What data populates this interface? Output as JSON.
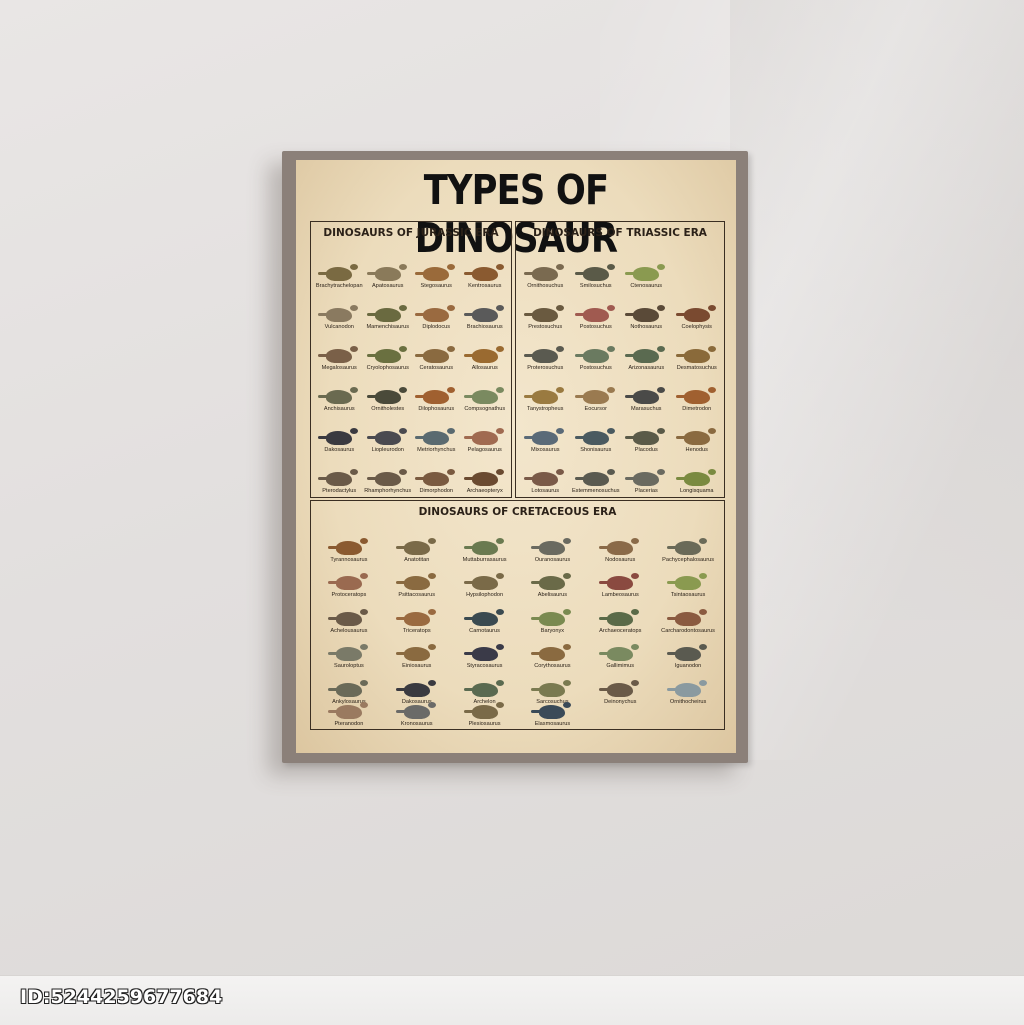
{
  "poster": {
    "title": "TYPES OF DINOSAUR",
    "colors": {
      "paper": "#ecdcbc",
      "ink": "#2b2118",
      "region_text": "#a33a2a",
      "frame": "#8b8079"
    },
    "jurassic": {
      "heading": "DINOSAURS OF JURASSIC ERA",
      "items": [
        {
          "name": "Brachytrachelopan",
          "color": "#7a6a42"
        },
        {
          "name": "Apatosaurus",
          "color": "#8a7a5a"
        },
        {
          "name": "Stegosaurus",
          "color": "#9a6a3a"
        },
        {
          "name": "Kentrosaurus",
          "color": "#8a5a30"
        },
        {
          "name": "Vulcanodon",
          "color": "#8a7a60"
        },
        {
          "name": "Mamenchisaurus",
          "color": "#6a6a40"
        },
        {
          "name": "Diplodocus",
          "color": "#9a6a40"
        },
        {
          "name": "Brachiosaurus",
          "color": "#5a5a5a"
        },
        {
          "name": "Megalosaurus",
          "color": "#7a6048"
        },
        {
          "name": "Cryolophosaurus",
          "color": "#6a7040"
        },
        {
          "name": "Ceratosaurus",
          "color": "#8a6a40"
        },
        {
          "name": "Allosaurus",
          "color": "#9a6a30"
        },
        {
          "name": "Anchisaurus",
          "color": "#6a6a50"
        },
        {
          "name": "Ornitholestes",
          "color": "#4a4a3a"
        },
        {
          "name": "Dilophosaurus",
          "color": "#a06030"
        },
        {
          "name": "Compsognathus",
          "color": "#7a8a60"
        },
        {
          "name": "Dakosaurus",
          "color": "#3a3a40"
        },
        {
          "name": "Liopleurodon",
          "color": "#4a4a50"
        },
        {
          "name": "Metriorhynchus",
          "color": "#5a6a70"
        },
        {
          "name": "Pelagosaurus",
          "color": "#a06a50"
        },
        {
          "name": "Pterodactylus",
          "color": "#6a5a48"
        },
        {
          "name": "Rhamphorhynchus",
          "color": "#6a5a48"
        },
        {
          "name": "Dimorphodon",
          "color": "#7a5a40"
        },
        {
          "name": "Archaeopteryx",
          "color": "#6a4a30"
        }
      ]
    },
    "triassic": {
      "heading": "DINOSAURS OF TRIASSIC ERA",
      "items": [
        {
          "name": "Ornithosuchus",
          "color": "#7a6a50"
        },
        {
          "name": "Smilosuchus",
          "color": "#5a5a48"
        },
        {
          "name": "Ctenosaurus",
          "color": "#8a9a50"
        },
        {
          "name": "",
          "color": "#00000000"
        },
        {
          "name": "Prestosuchus",
          "color": "#6a5a40"
        },
        {
          "name": "Postosuchus",
          "color": "#a05a50"
        },
        {
          "name": "Nothosaurus",
          "color": "#5a4a38"
        },
        {
          "name": "Coelophysis",
          "color": "#7a4a30"
        },
        {
          "name": "Proterosuchus",
          "color": "#5a5a50"
        },
        {
          "name": "Postosuchus",
          "color": "#6a7a60"
        },
        {
          "name": "Arizonasaurus",
          "color": "#5a6a50"
        },
        {
          "name": "Desmatosuchus",
          "color": "#8a6a3a"
        },
        {
          "name": "Tanystropheus",
          "color": "#9a7a40"
        },
        {
          "name": "Eocursor",
          "color": "#9a7a50"
        },
        {
          "name": "Marasuchus",
          "color": "#4a4a48"
        },
        {
          "name": "Dimetrodon",
          "color": "#a06030"
        },
        {
          "name": "Mixosaurus",
          "color": "#5a6a78"
        },
        {
          "name": "Shonisaurus",
          "color": "#4a5a60"
        },
        {
          "name": "Placodus",
          "color": "#5a5a48"
        },
        {
          "name": "Henodus",
          "color": "#8a6a40"
        },
        {
          "name": "Lotosaurus",
          "color": "#7a5a48"
        },
        {
          "name": "Estemmenosuchus",
          "color": "#5a5a50"
        },
        {
          "name": "Placerias",
          "color": "#6a6a60"
        },
        {
          "name": "Longisquama",
          "color": "#7a8a40"
        }
      ]
    },
    "cretaceous": {
      "heading": "DINOSAURS OF CRETACEOUS ERA",
      "items": [
        {
          "name": "Tyrannosaurus",
          "color": "#8a5a30"
        },
        {
          "name": "Anatotitan",
          "color": "#7a6a48"
        },
        {
          "name": "Muttaburrasaurus",
          "color": "#6a7a50"
        },
        {
          "name": "Ouranosaurus",
          "color": "#6a6a60"
        },
        {
          "name": "Nodosaurus",
          "color": "#8a6a48"
        },
        {
          "name": "Pachycephalosaurus",
          "color": "#6a6a58"
        },
        {
          "name": "Protoceratops",
          "color": "#9a6a50"
        },
        {
          "name": "Psittacosaurus",
          "color": "#8a6a40"
        },
        {
          "name": "Hypsilophodon",
          "color": "#7a6a48"
        },
        {
          "name": "Abelisaurus",
          "color": "#6a6a48"
        },
        {
          "name": "Lambeosaurus",
          "color": "#8a4a40"
        },
        {
          "name": "Tsintaosaurus",
          "color": "#8a9a50"
        },
        {
          "name": "Achelousaurus",
          "color": "#6a5a48"
        },
        {
          "name": "Triceratops",
          "color": "#9a6a40"
        },
        {
          "name": "Carnotaurus",
          "color": "#3a4a50"
        },
        {
          "name": "Baryonyx",
          "color": "#7a8a50"
        },
        {
          "name": "Archaeoceratops",
          "color": "#5a6a48"
        },
        {
          "name": "Carcharodontosaurus",
          "color": "#8a5a40"
        },
        {
          "name": "Sauroloptus",
          "color": "#7a7a68"
        },
        {
          "name": "Einiosaurus",
          "color": "#8a6a40"
        },
        {
          "name": "Styracosaurus",
          "color": "#3a3a48"
        },
        {
          "name": "Corythosaurus",
          "color": "#8a6a40"
        },
        {
          "name": "Gallimimus",
          "color": "#7a8a60"
        },
        {
          "name": "Iguanodon",
          "color": "#5a5a50"
        },
        {
          "name": "Ankylosaurus",
          "color": "#6a6a58"
        },
        {
          "name": "Dakosaurus",
          "color": "#3a3a40"
        },
        {
          "name": "Archelon",
          "color": "#5a6a50"
        },
        {
          "name": "Sarcosuchus",
          "color": "#7a7a50"
        },
        {
          "name": "Deinonychus",
          "color": "#6a5a48"
        },
        {
          "name": "Ornithocheirus",
          "color": "#8a9aa0"
        },
        {
          "name": "Pteranodon",
          "color": "#9a7a60"
        },
        {
          "name": "Kronosaurus",
          "color": "#6a6a68"
        },
        {
          "name": "Plesiosaurus",
          "color": "#7a6a48"
        },
        {
          "name": "Elasmosaurus",
          "color": "#3a4a58"
        }
      ]
    }
  },
  "watermark": "ID:5244259677684"
}
